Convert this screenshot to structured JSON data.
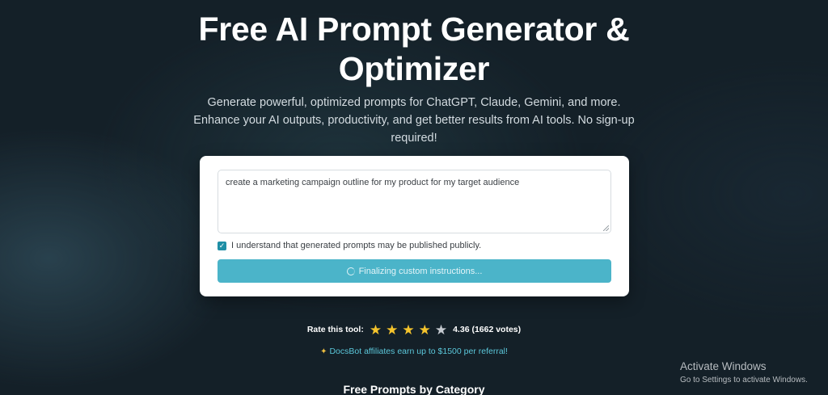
{
  "hero": {
    "title_line1": "Free AI Prompt Generator &",
    "title_line2": "Optimizer",
    "subtitle": "Generate powerful, optimized prompts for ChatGPT, Claude, Gemini, and more. Enhance your AI outputs, productivity, and get better results from AI tools. No sign-up required!"
  },
  "form": {
    "prompt_value": "create a marketing campaign outline for my product for my target audience",
    "consent_checked": true,
    "consent_label": "I understand that generated prompts may be published publicly.",
    "button_label": "Finalizing custom instructions...",
    "button_state": "loading"
  },
  "rating": {
    "label": "Rate this tool:",
    "stars_filled": 4,
    "stars_total": 5,
    "score_text": "4.36 (1662 votes)"
  },
  "affiliate": {
    "icon": "party-popper-icon",
    "text": "DocsBot affiliates earn up to $1500 per referral!"
  },
  "categories_heading": "Free Prompts by Category",
  "windows_activation": {
    "title": "Activate Windows",
    "subtitle": "Go to Settings to activate Windows."
  },
  "colors": {
    "background": "#142028",
    "accent": "#4bb4c9",
    "checkbox": "#1f8fa6",
    "star": "#f5c42c",
    "link": "#5bc7da"
  }
}
